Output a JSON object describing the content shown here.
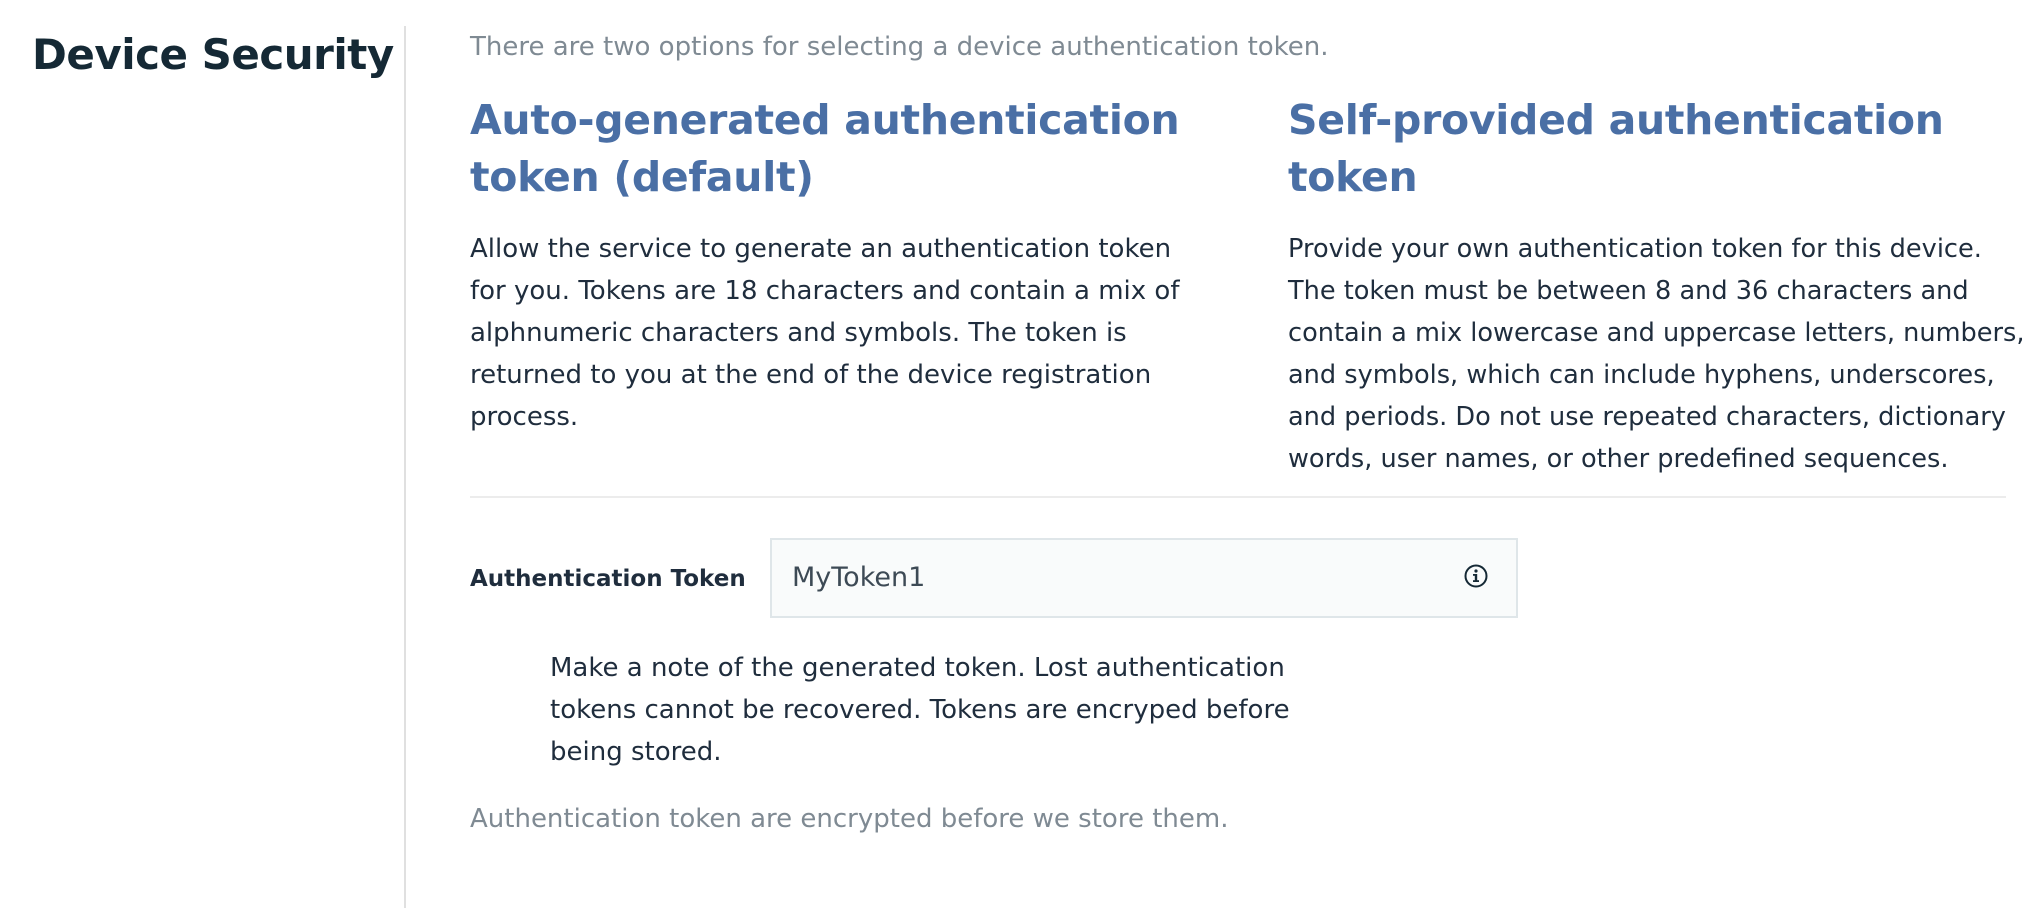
{
  "page": {
    "title": "Device Security"
  },
  "intro": "There are two options for selecting a device authentication token.",
  "options": [
    {
      "heading": "Auto-generated authentication token (default)",
      "body": "Allow the service to generate an authentication token for you. Tokens are 18 characters and contain a mix of alphnumeric characters and symbols. The token is returned to you at the end of the device registration process."
    },
    {
      "heading": "Self-provided authentication token",
      "body": "Provide your own authentication token for this device. The token must be between 8 and 36 characters and contain a mix lowercase and uppercase letters, numbers, and symbols, which can include hyphens, underscores, and periods. Do not use repeated characters, dictionary words, user names, or other predefined sequences."
    }
  ],
  "token_field": {
    "label": "Authentication Token",
    "value": "MyToken1",
    "icon": "info-icon"
  },
  "note": "Make a note of the generated token. Lost authentication tokens cannot be recovered. Tokens are encryped before being stored.",
  "footer": "Authentication token are encrypted before we store them.",
  "colors": {
    "heading_accent": "#4a6fa5",
    "title": "#152935",
    "muted_text": "#7f8a93",
    "body_text": "#1f2d3d"
  }
}
